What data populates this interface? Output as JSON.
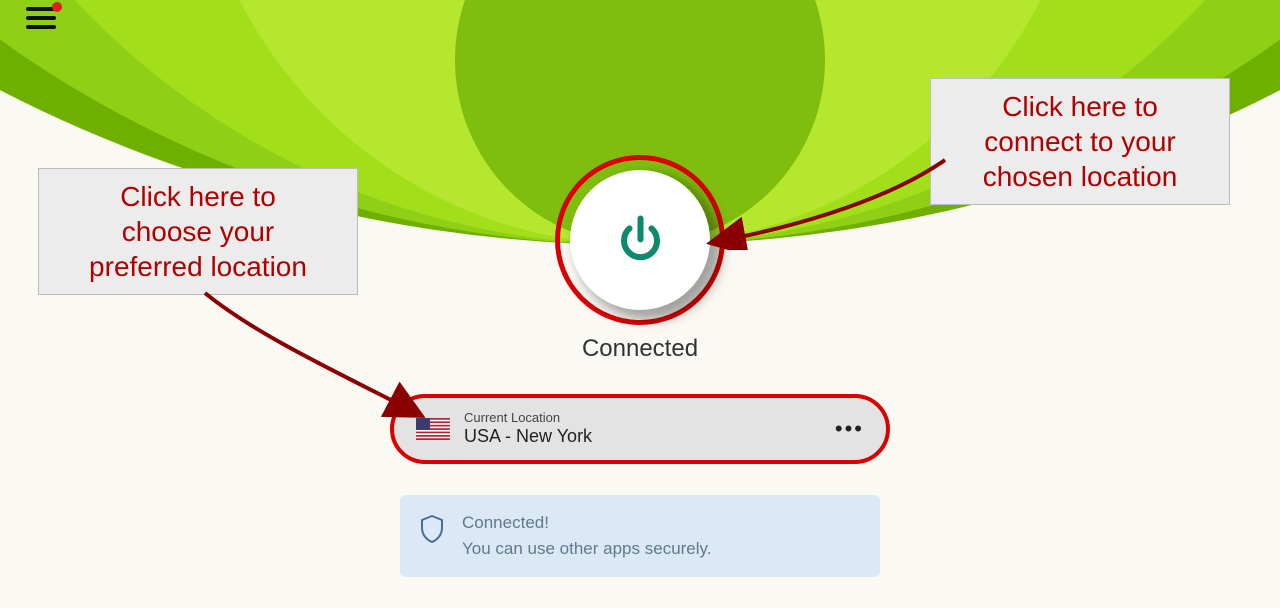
{
  "menu": {
    "notification": true
  },
  "connection": {
    "status_label": "Connected"
  },
  "location": {
    "label": "Current Location",
    "value": "USA - New York",
    "flag": "us",
    "more_label": "•••"
  },
  "status_banner": {
    "title": "Connected!",
    "subtitle": "You can use other apps securely."
  },
  "callouts": {
    "left": {
      "line1": "Click here to",
      "line2": "choose your",
      "line3": "preferred location"
    },
    "right": {
      "line1": "Click here to",
      "line2": "connect to your",
      "line3": "chosen location"
    }
  },
  "colors": {
    "annotation": "#d90000",
    "accent": "#0d8a6a"
  }
}
